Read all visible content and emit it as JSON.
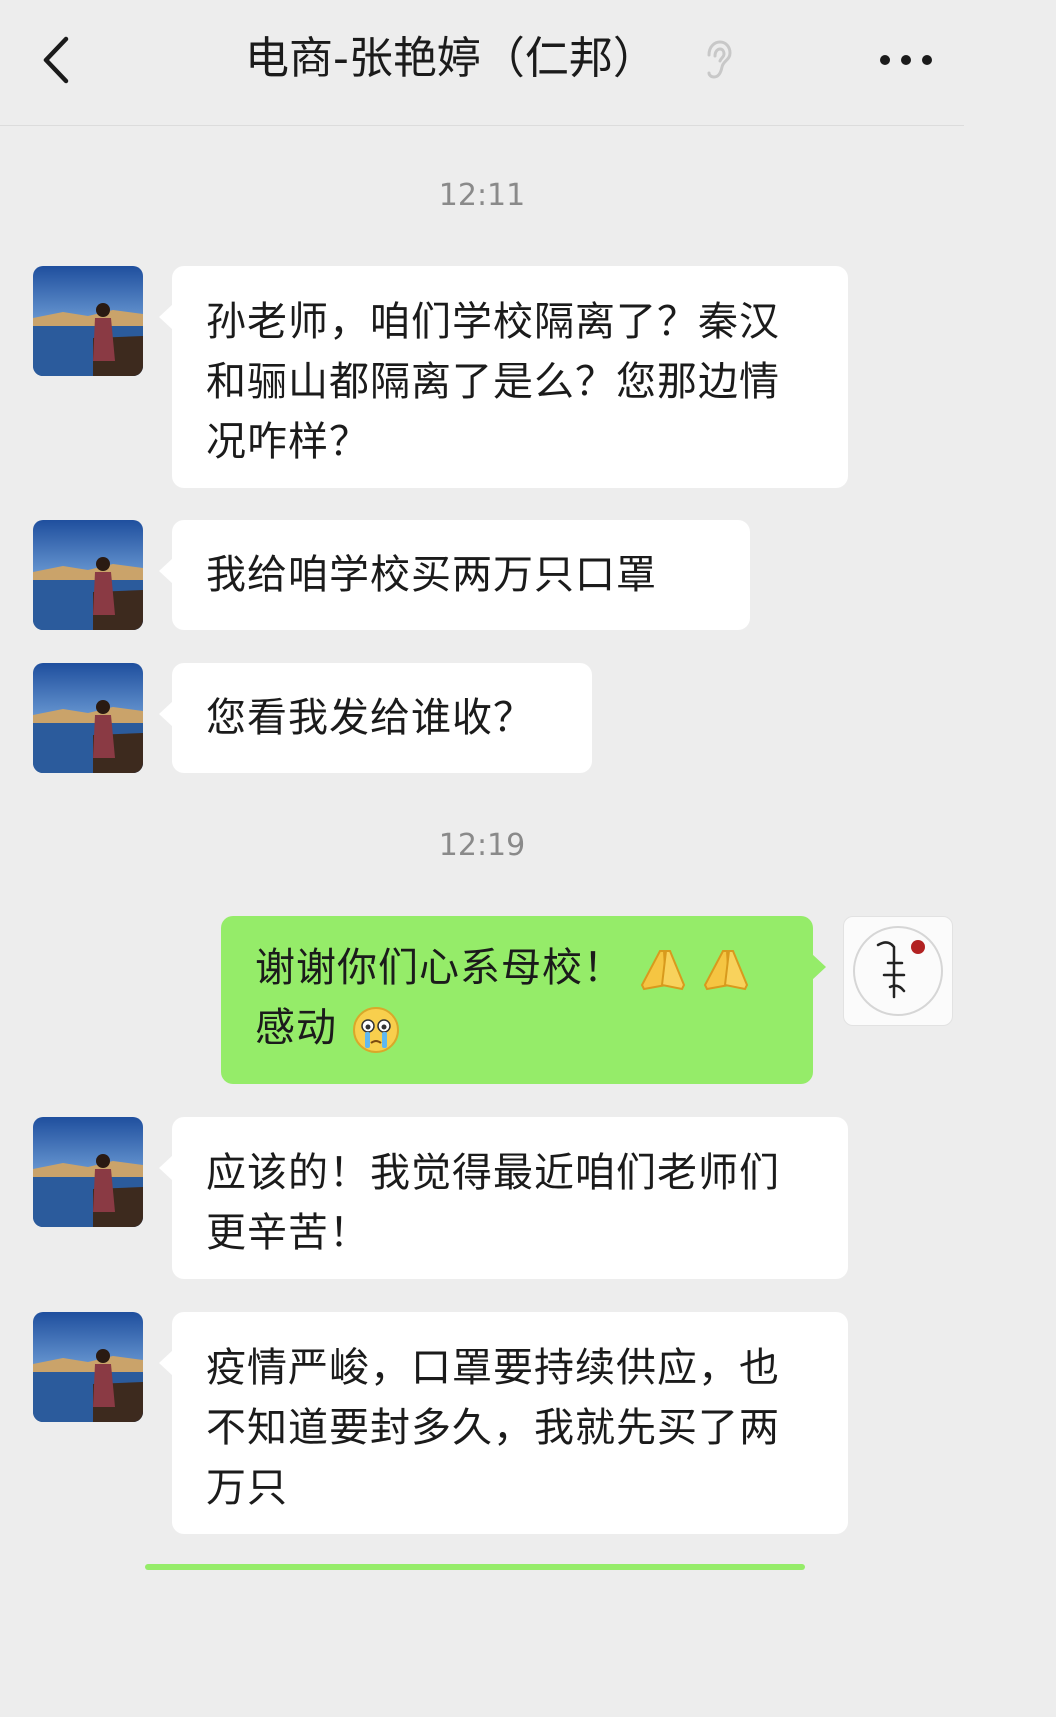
{
  "header": {
    "title": "电商-张艳婷（仁邦）",
    "back_icon": "chevron-left-icon",
    "status_icon": "ear-icon",
    "more_icon": "more-dots-icon"
  },
  "timestamps": [
    "12:11",
    "12:19"
  ],
  "messages": [
    {
      "sender": "contact",
      "text": "孙老师，咱们学校隔离了？秦汉和骊山都隔离了是么？您那边情况咋样？"
    },
    {
      "sender": "contact",
      "text": "我给咱学校买两万只口罩"
    },
    {
      "sender": "contact",
      "text": "您看我发给谁收？"
    },
    {
      "sender": "self",
      "text": "谢谢你们心系母校！",
      "text2": "感动",
      "emojis": [
        "pray-hands-emoji",
        "pray-hands-emoji",
        "crying-emoji"
      ]
    },
    {
      "sender": "contact",
      "text": "应该的！我觉得最近咱们老师们更辛苦！"
    },
    {
      "sender": "contact",
      "text": "疫情严峻，口罩要持续供应，也不知道要封多久，我就先买了两万只"
    }
  ],
  "colors": {
    "background": "#ededed",
    "incoming_bubble": "#ffffff",
    "outgoing_bubble": "#95ec69",
    "timestamp": "#8a8a8a"
  }
}
